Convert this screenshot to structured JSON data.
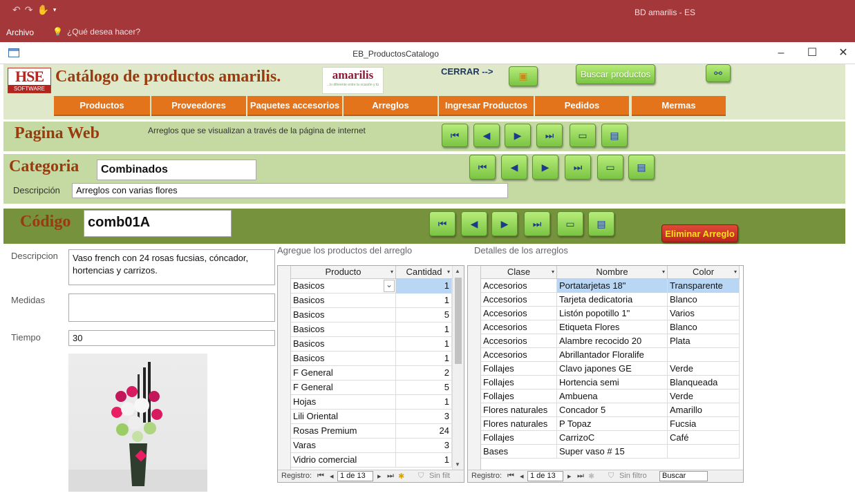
{
  "app": {
    "title": "BD amarilis - ES",
    "menu_file": "Archivo",
    "tell_me": "¿Qué desea hacer?"
  },
  "form": {
    "title": "EB_ProductosCatalogo"
  },
  "header": {
    "logo_hse": "HSE",
    "logo_hse_sub": "SOFTWARE",
    "title": "Catálogo de productos amarilis.",
    "logo_amarilis": "amarilis",
    "logo_amarilis_sub": "...lo diferente entre la ocasión y tú",
    "cerrar_label": "CERRAR -->",
    "search_button": "Buscar productos"
  },
  "tabs": [
    "Productos",
    "Proveedores",
    "Paquetes accesorios",
    "Arreglos",
    "Ingresar Productos",
    "Pedidos",
    "Mermas"
  ],
  "web": {
    "title": "Pagina Web",
    "subtitle": "Arreglos que se visualizan a través de la página de internet"
  },
  "categoria": {
    "title": "Categoria",
    "value": "Combinados",
    "desc_label": "Descripción",
    "desc_value": "Arreglos con varias flores"
  },
  "codigo": {
    "title": "Código",
    "value": "comb01A",
    "delete_button": "Eliminar Arreglo"
  },
  "detail": {
    "descripcion_label": "Descripcion",
    "descripcion_value": "Vaso french con 24 rosas fucsias, cóncador, hortencias y carrizos.",
    "medidas_label": "Medidas",
    "medidas_value": "",
    "tiempo_label": "Tiempo",
    "tiempo_value": "30"
  },
  "products": {
    "caption": "Agregue los productos del arreglo",
    "headers": [
      "Producto",
      "Cantidad"
    ],
    "rows": [
      [
        "Basicos",
        "1"
      ],
      [
        "Basicos",
        "1"
      ],
      [
        "Basicos",
        "5"
      ],
      [
        "Basicos",
        "1"
      ],
      [
        "Basicos",
        "1"
      ],
      [
        "Basicos",
        "1"
      ],
      [
        "F General",
        "2"
      ],
      [
        "F General",
        "5"
      ],
      [
        "Hojas",
        "1"
      ],
      [
        "Lili Oriental",
        "3"
      ],
      [
        "Rosas Premium",
        "24"
      ],
      [
        "Varas",
        "3"
      ],
      [
        "Vidrio comercial",
        "1"
      ]
    ],
    "nav_label": "Registro:",
    "nav_record": "1 de 13",
    "nav_filter": "Sin filt"
  },
  "arrangements": {
    "caption": "Detalles de los arreglos",
    "headers": [
      "Clase",
      "Nombre",
      "Color"
    ],
    "rows": [
      [
        "Accesorios",
        "Portatarjetas 18\"",
        "Transparente"
      ],
      [
        "Accesorios",
        "Tarjeta dedicatoria",
        "Blanco"
      ],
      [
        "Accesorios",
        "Listón popotillo 1\"",
        "Varios"
      ],
      [
        "Accesorios",
        "Etiqueta Flores",
        "Blanco"
      ],
      [
        "Accesorios",
        "Alambre recocido 20",
        "Plata"
      ],
      [
        "Accesorios",
        "Abrillantador Floralife",
        ""
      ],
      [
        "Follajes",
        "Clavo japones GE",
        "Verde"
      ],
      [
        "Follajes",
        "Hortencia semi",
        "Blanqueada"
      ],
      [
        "Follajes",
        "Ambuena",
        "Verde"
      ],
      [
        "Flores naturales",
        "Concador 5",
        "Amarillo"
      ],
      [
        "Flores naturales",
        "P Topaz",
        "Fucsia"
      ],
      [
        "Follajes",
        "CarrizoC",
        "Café"
      ],
      [
        "Bases",
        "Super vaso # 15",
        ""
      ]
    ],
    "nav_label": "Registro:",
    "nav_record": "1 de 13",
    "nav_filter": "Sin filtro",
    "nav_search": "Buscar"
  },
  "colors": {
    "titlebar": "#a4373a",
    "header_band": "#dfe8c9",
    "section_band": "#c5d9a2",
    "codigo_band": "#76923c",
    "tab_orange": "#e4741c",
    "title_brown": "#9a3b0e"
  }
}
